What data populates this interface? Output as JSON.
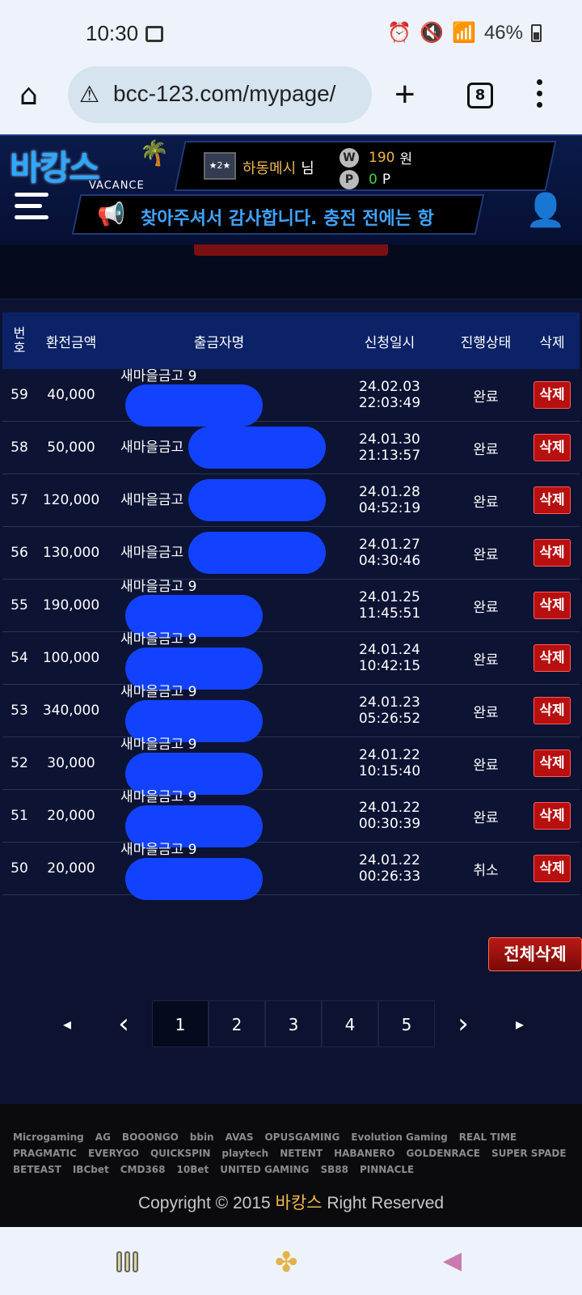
{
  "status_bar": {
    "time": "10:30",
    "battery": "46%",
    "icons": [
      "image-icon",
      "alarm-icon",
      "mute-icon",
      "wifi-icon",
      "signal-icon",
      "battery-icon"
    ]
  },
  "browser": {
    "url": "bcc-123.com/mypage/",
    "tab_count": "8"
  },
  "site": {
    "logo_kr": "바캉스",
    "logo_en": "VACANCE",
    "rank": "2",
    "username": "하동메시",
    "username_suffix": "님",
    "money_icon": "W",
    "money": "190",
    "money_unit": "원",
    "point_icon": "P",
    "points": "0",
    "points_unit": "P",
    "notice": "찾아주셔서 감사합니다. 충전 전에는 항"
  },
  "table": {
    "headers": {
      "no": "번호",
      "amount": "환전금액",
      "name": "출금자명",
      "date": "신청일시",
      "status": "진행상태",
      "delete": "삭제"
    },
    "rows": [
      {
        "no": "59",
        "amount": "40,000",
        "name": "새마을금고 9",
        "date": "24.02.03 22:03:49",
        "status": "완료",
        "delete": "삭제"
      },
      {
        "no": "58",
        "amount": "50,000",
        "name": "새마을금고",
        "date": "24.01.30 21:13:57",
        "status": "완료",
        "delete": "삭제"
      },
      {
        "no": "57",
        "amount": "120,000",
        "name": "새마을금고",
        "date": "24.01.28 04:52:19",
        "status": "완료",
        "delete": "삭제"
      },
      {
        "no": "56",
        "amount": "130,000",
        "name": "새마을금고",
        "date": "24.01.27 04:30:46",
        "status": "완료",
        "delete": "삭제"
      },
      {
        "no": "55",
        "amount": "190,000",
        "name": "새마을금고 9",
        "date": "24.01.25 11:45:51",
        "status": "완료",
        "delete": "삭제"
      },
      {
        "no": "54",
        "amount": "100,000",
        "name": "새마을금고 9",
        "date": "24.01.24 10:42:15",
        "status": "완료",
        "delete": "삭제"
      },
      {
        "no": "53",
        "amount": "340,000",
        "name": "새마을금고 9",
        "date": "24.01.23 05:26:52",
        "status": "완료",
        "delete": "삭제"
      },
      {
        "no": "52",
        "amount": "30,000",
        "name": "새마을금고 9",
        "date": "24.01.22 10:15:40",
        "status": "완료",
        "delete": "삭제"
      },
      {
        "no": "51",
        "amount": "20,000",
        "name": "새마을금고 9",
        "date": "24.01.22 00:30:39",
        "status": "완료",
        "delete": "삭제"
      },
      {
        "no": "50",
        "amount": "20,000",
        "name": "새마을금고 9",
        "date": "24.01.22 00:26:33",
        "status": "취소",
        "delete": "삭제"
      }
    ]
  },
  "delete_all": "전체삭제",
  "pagination": {
    "first": "◂",
    "prev": "‹",
    "pages": [
      "1",
      "2",
      "3",
      "4",
      "5"
    ],
    "next": "›",
    "last": "▸",
    "current": "1"
  },
  "footer": {
    "providers": [
      "Microgaming",
      "AG",
      "BOOONGO",
      "bbin",
      "AVAS",
      "OPUSGAMING",
      "Evolution Gaming",
      "REAL TIME",
      "PRAGMATIC",
      "EVERYGO",
      "QUICKSPIN",
      "playtech",
      "NETENT",
      "HABANERO",
      "GOLDENRACE",
      "SUPER SPADE",
      "BETEAST",
      "IBCbet",
      "CMD368",
      "10Bet",
      "UNITED GAMING",
      "SB88",
      "PINNACLE"
    ],
    "copyright_prefix": "Copyright © 2015",
    "brand": "바캉스",
    "copyright_suffix": "Right Reserved"
  }
}
